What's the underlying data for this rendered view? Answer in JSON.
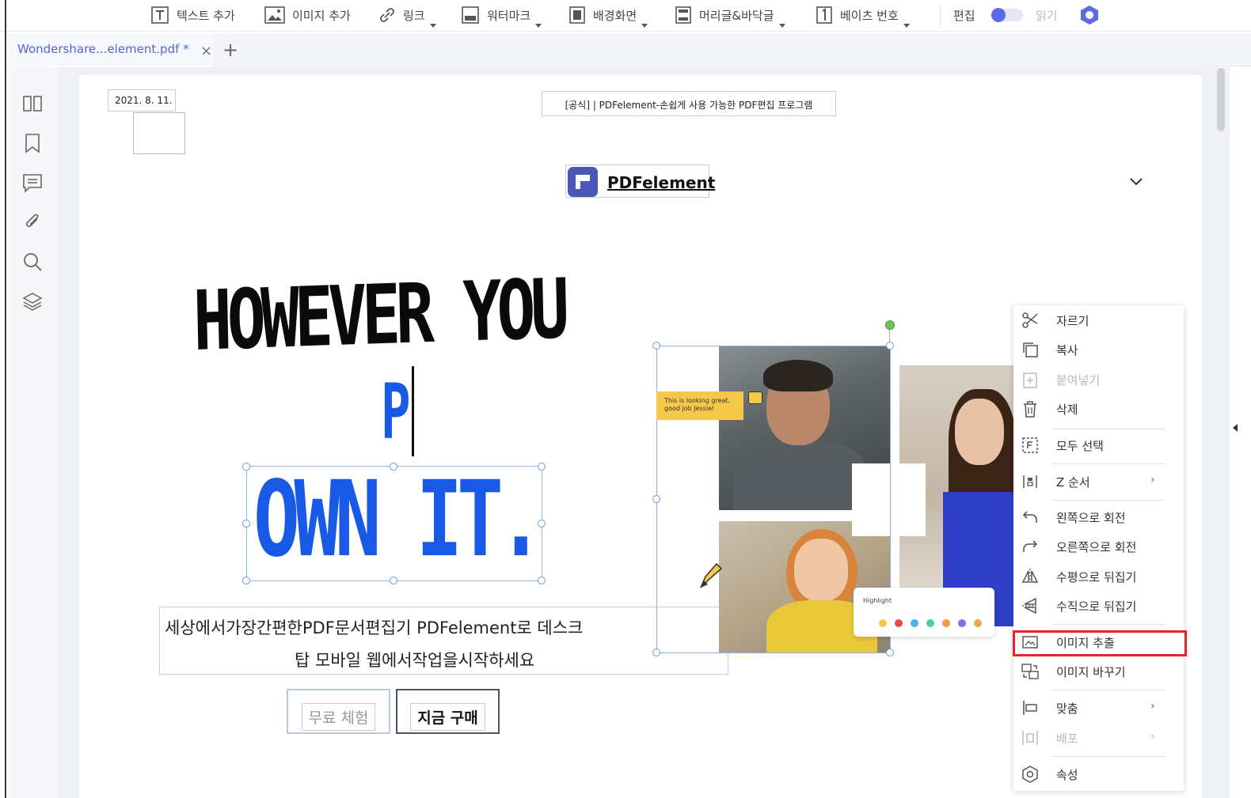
{
  "toolbar": {
    "add_text": "텍스트 추가",
    "add_image": "이미지 추가",
    "link": "링크",
    "watermark": "워터마크",
    "background": "배경화면",
    "header_footer": "머리글&바닥글",
    "bates_number": "베이츠 번호",
    "edit": "편집",
    "read": "읽기"
  },
  "tab": {
    "title": "Wondershare...element.pdf *",
    "close": "×",
    "add": "+"
  },
  "page": {
    "date": "2021. 8. 11.",
    "header": "[공식] | PDFelement-손쉽게 사용 가능한 PDF편집 프로그램",
    "logo_text": "PDFelement",
    "headline": "HOWEVER YOU",
    "p_letter": "P",
    "own_it": "OWN IT.",
    "description_line1": "세상에서가장간편한PDF문서편집기  PDFelement로 데스크",
    "description_line2": "탑   모바일   웹에서작업을시작하세요",
    "btn_trial": "무료 체험",
    "btn_buy": "지금 구매",
    "sticky_note": "This is looking great, good job Jessie!",
    "highlight_label": "Highlight"
  },
  "context_menu": {
    "items": [
      {
        "label": "자르기",
        "icon": "scissors-icon",
        "enabled": true
      },
      {
        "label": "복사",
        "icon": "copy-icon",
        "enabled": true
      },
      {
        "label": "붙여넣기",
        "icon": "paste-icon",
        "enabled": false
      },
      {
        "label": "삭제",
        "icon": "trash-icon",
        "enabled": true
      },
      {
        "label": "모두 선택",
        "icon": "select-all-icon",
        "enabled": true
      },
      {
        "label": "Z 순서",
        "icon": "z-order-icon",
        "enabled": true,
        "submenu": true
      },
      {
        "label": "왼쪽으로 회전",
        "icon": "rotate-left-icon",
        "enabled": true
      },
      {
        "label": "오른쪽으로 회전",
        "icon": "rotate-right-icon",
        "enabled": true
      },
      {
        "label": "수평으로 뒤집기",
        "icon": "flip-horizontal-icon",
        "enabled": true
      },
      {
        "label": "수직으로 뒤집기",
        "icon": "flip-vertical-icon",
        "enabled": true
      },
      {
        "label": "이미지 추출",
        "icon": "extract-image-icon",
        "enabled": true,
        "highlighted": true
      },
      {
        "label": "이미지 바꾸기",
        "icon": "replace-image-icon",
        "enabled": true
      },
      {
        "label": "맞춤",
        "icon": "align-icon",
        "enabled": true,
        "submenu": true
      },
      {
        "label": "배포",
        "icon": "distribute-icon",
        "enabled": false,
        "submenu": true
      },
      {
        "label": "속성",
        "icon": "settings-icon",
        "enabled": true
      }
    ],
    "submenu_arrow": "›"
  },
  "colors": {
    "accent": "#5c6bea",
    "own_it_blue": "#1859e6",
    "highlight_border": "#e0262e",
    "logo": "#4a56b8"
  }
}
